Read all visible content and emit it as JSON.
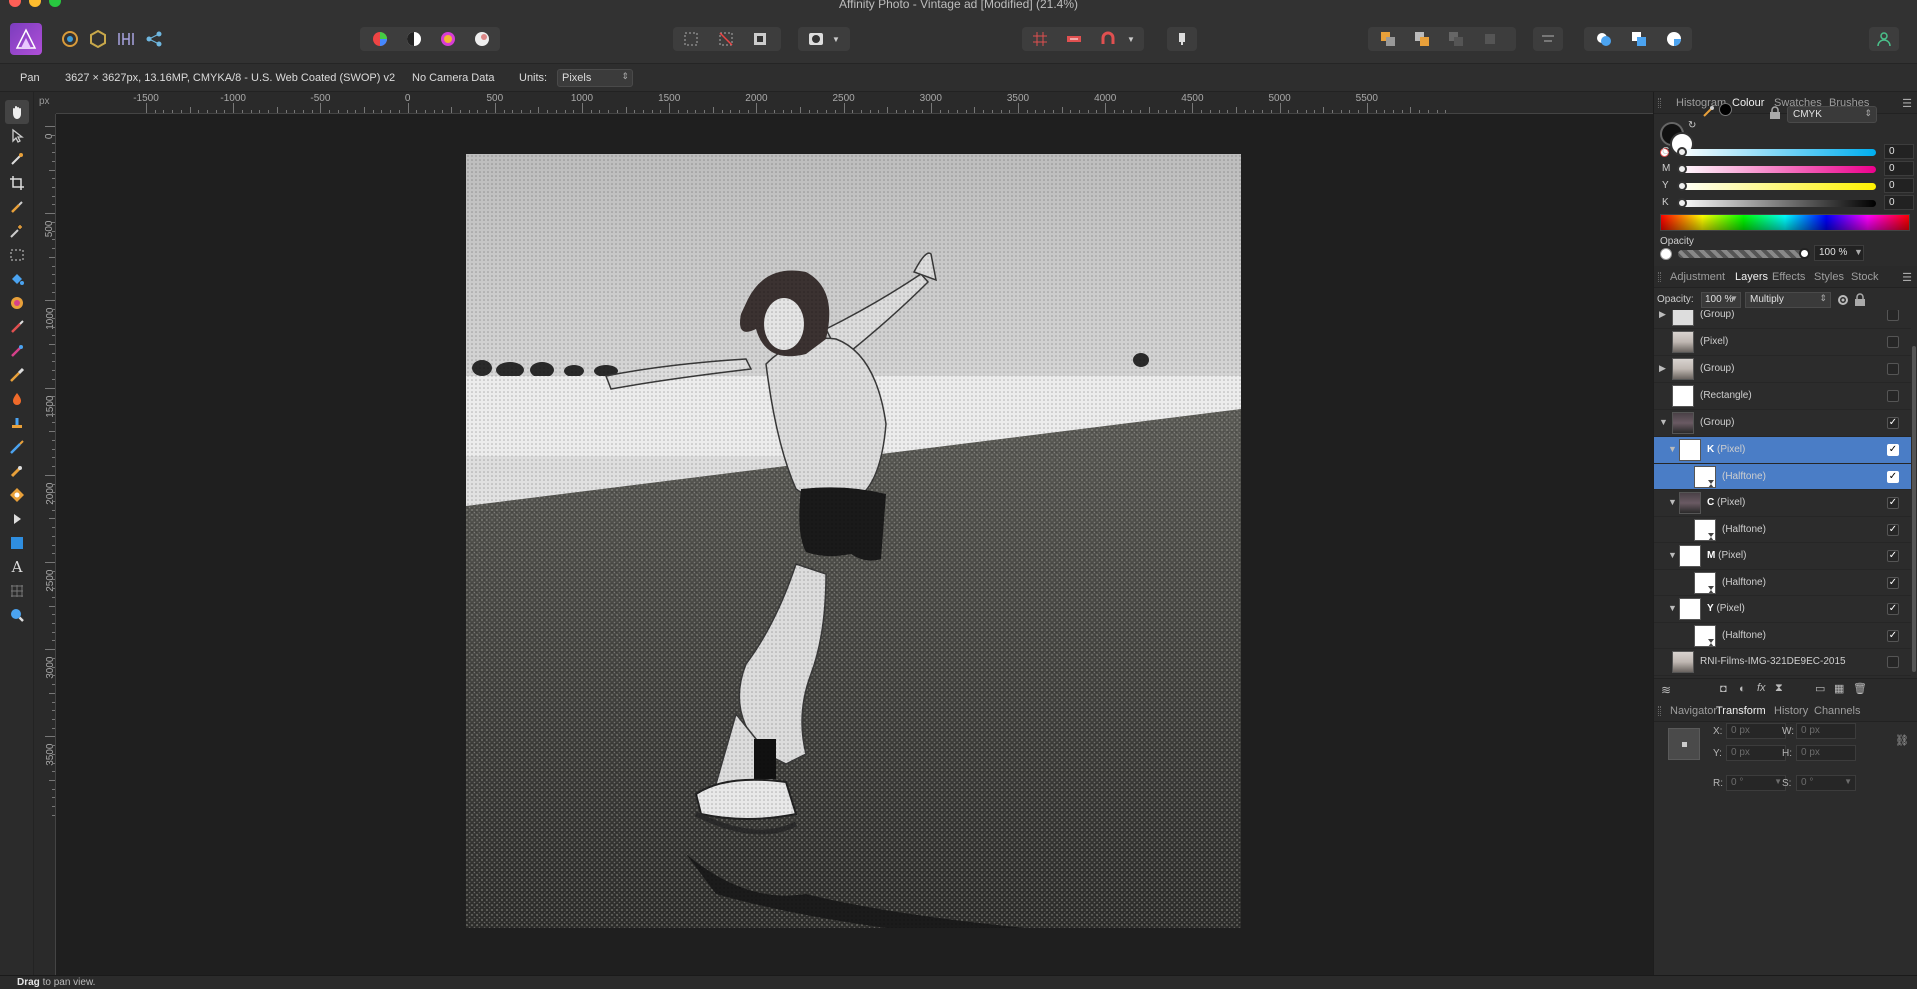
{
  "window": {
    "title": "Affinity Photo - Vintage ad [Modified] (21.4%)"
  },
  "context": {
    "tool_name": "Pan",
    "doc_info": "3627 × 3627px, 13.16MP, CMYKA/8 - U.S. Web Coated (SWOP) v2",
    "camera": "No Camera Data",
    "units_label": "Units:",
    "units_value": "Pixels"
  },
  "ruler": {
    "unit": "px",
    "h_labels": [
      "-1500",
      "-1000",
      "-500",
      "0",
      "500",
      "1000",
      "1500",
      "2000",
      "2500",
      "3000",
      "3500",
      "4000",
      "4500",
      "5000",
      "5500"
    ],
    "v_labels": [
      "0",
      "500",
      "1000",
      "1500",
      "2000",
      "2500",
      "3000",
      "3500"
    ]
  },
  "status": {
    "bold": "Drag",
    "rest": " to pan view."
  },
  "colour_panel": {
    "tabs": [
      "Histogram",
      "Colour",
      "Swatches",
      "Brushes"
    ],
    "active_tab": "Colour",
    "model": "CMYK",
    "channels": [
      {
        "label": "C",
        "value": "0",
        "color_from": "#ffffff",
        "color_to": "#00aeef"
      },
      {
        "label": "M",
        "value": "0",
        "color_from": "#ffffff",
        "color_to": "#ec008c"
      },
      {
        "label": "Y",
        "value": "0",
        "color_from": "#ffffff",
        "color_to": "#fff200"
      },
      {
        "label": "K",
        "value": "0",
        "color_from": "#ffffff",
        "color_to": "#000000"
      }
    ],
    "opacity_label": "Opacity",
    "opacity_value": "100 %"
  },
  "layers_panel": {
    "tabs": [
      "Adjustment",
      "Layers",
      "Effects",
      "Styles",
      "Stock"
    ],
    "active_tab": "Layers",
    "opacity_label": "Opacity:",
    "opacity_value": "100 %",
    "blend_mode": "Multiply",
    "layers": [
      {
        "prefix": "",
        "name": "(Group)",
        "arrow": "▶",
        "indent": 0,
        "thumb": "text",
        "checked": false,
        "selected": false
      },
      {
        "prefix": "",
        "name": "(Pixel)",
        "arrow": "",
        "indent": 0,
        "thumb": "photo",
        "checked": false,
        "selected": false
      },
      {
        "prefix": "",
        "name": "(Group)",
        "arrow": "▶",
        "indent": 0,
        "thumb": "photo",
        "checked": false,
        "selected": false
      },
      {
        "prefix": "",
        "name": "(Rectangle)",
        "arrow": "",
        "indent": 0,
        "thumb": "white",
        "checked": false,
        "selected": false
      },
      {
        "prefix": "",
        "name": "(Group)",
        "arrow": "▼",
        "indent": 0,
        "thumb": "dark",
        "checked": true,
        "selected": false
      },
      {
        "prefix": "K",
        "name": "(Pixel)",
        "arrow": "▼",
        "indent": 1,
        "thumb": "white",
        "checked": true,
        "selected": true
      },
      {
        "prefix": "",
        "name": "(Halftone)",
        "arrow": "",
        "indent": 2,
        "thumb": "halftone",
        "checked": true,
        "selected": true
      },
      {
        "prefix": "C",
        "name": "(Pixel)",
        "arrow": "▼",
        "indent": 1,
        "thumb": "dark",
        "checked": true,
        "selected": false
      },
      {
        "prefix": "",
        "name": "(Halftone)",
        "arrow": "",
        "indent": 2,
        "thumb": "halftone",
        "checked": true,
        "selected": false
      },
      {
        "prefix": "M",
        "name": "(Pixel)",
        "arrow": "▼",
        "indent": 1,
        "thumb": "white",
        "checked": true,
        "selected": false
      },
      {
        "prefix": "",
        "name": "(Halftone)",
        "arrow": "",
        "indent": 2,
        "thumb": "halftone",
        "checked": true,
        "selected": false
      },
      {
        "prefix": "Y",
        "name": "(Pixel)",
        "arrow": "▼",
        "indent": 1,
        "thumb": "white",
        "checked": true,
        "selected": false
      },
      {
        "prefix": "",
        "name": "(Halftone)",
        "arrow": "",
        "indent": 2,
        "thumb": "halftone",
        "checked": true,
        "selected": false
      },
      {
        "prefix": "",
        "name": "RNI-Films-IMG-321DE9EC-2015",
        "arrow": "",
        "indent": 0,
        "thumb": "photo",
        "checked": false,
        "selected": false
      }
    ]
  },
  "transform_panel": {
    "tabs": [
      "Navigator",
      "Transform",
      "History",
      "Channels"
    ],
    "active_tab": "Transform",
    "x_label": "X:",
    "x_value": "0 px",
    "y_label": "Y:",
    "y_value": "0 px",
    "w_label": "W:",
    "w_value": "0 px",
    "h_label": "H:",
    "h_value": "0 px",
    "r_label": "R:",
    "r_value": "0 °",
    "s_label": "S:",
    "s_value": "0 °"
  }
}
